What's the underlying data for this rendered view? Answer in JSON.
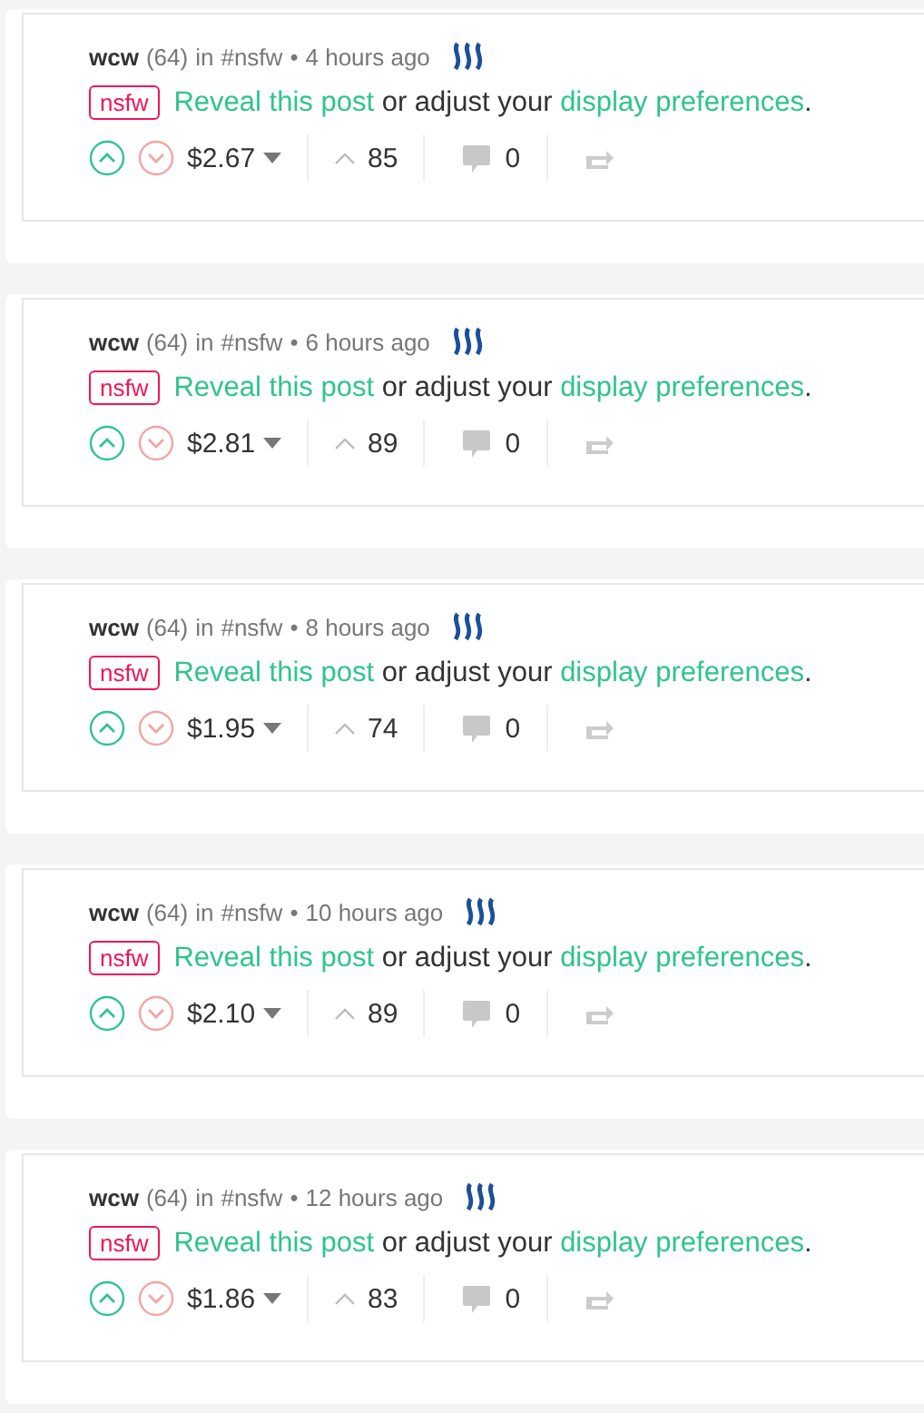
{
  "posts": [
    {
      "author": "wcw",
      "reputation": "(64)",
      "in_label": "in",
      "category": "#nsfw",
      "separator": "•",
      "time": "4 hours ago",
      "tag": "nsfw",
      "reveal_link": "Reveal this post",
      "middle_text": "or adjust your",
      "prefs_link": "display preferences",
      "end_mark": ".",
      "payout": "$2.67",
      "votes": "85",
      "comments": "0"
    },
    {
      "author": "wcw",
      "reputation": "(64)",
      "in_label": "in",
      "category": "#nsfw",
      "separator": "•",
      "time": "6 hours ago",
      "tag": "nsfw",
      "reveal_link": "Reveal this post",
      "middle_text": "or adjust your",
      "prefs_link": "display preferences",
      "end_mark": ".",
      "payout": "$2.81",
      "votes": "89",
      "comments": "0"
    },
    {
      "author": "wcw",
      "reputation": "(64)",
      "in_label": "in",
      "category": "#nsfw",
      "separator": "•",
      "time": "8 hours ago",
      "tag": "nsfw",
      "reveal_link": "Reveal this post",
      "middle_text": "or adjust your",
      "prefs_link": "display preferences",
      "end_mark": ".",
      "payout": "$1.95",
      "votes": "74",
      "comments": "0"
    },
    {
      "author": "wcw",
      "reputation": "(64)",
      "in_label": "in",
      "category": "#nsfw",
      "separator": "•",
      "time": "10 hours ago",
      "tag": "nsfw",
      "reveal_link": "Reveal this post",
      "middle_text": "or adjust your",
      "prefs_link": "display preferences",
      "end_mark": ".",
      "payout": "$2.10",
      "votes": "89",
      "comments": "0"
    },
    {
      "author": "wcw",
      "reputation": "(64)",
      "in_label": "in",
      "category": "#nsfw",
      "separator": "•",
      "time": "12 hours ago",
      "tag": "nsfw",
      "reveal_link": "Reveal this post",
      "middle_text": "or adjust your",
      "prefs_link": "display preferences",
      "end_mark": ".",
      "payout": "$1.86",
      "votes": "83",
      "comments": "0"
    }
  ]
}
